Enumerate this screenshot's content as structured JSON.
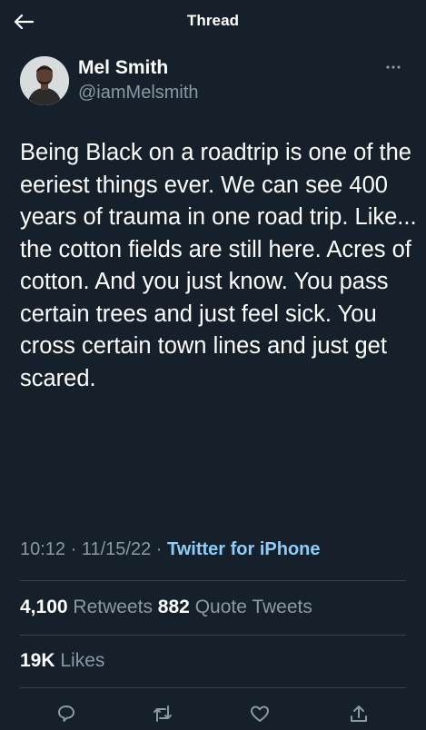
{
  "header": {
    "title": "Thread",
    "back_icon": "arrow-left-icon"
  },
  "author": {
    "name": "Mel Smith",
    "handle": "@iamMelsmith"
  },
  "tweet": {
    "text": "Being Black on a roadtrip is one of the eeriest things ever. We can see 400 years of trauma in one road trip. Like... the cotton fields are still here. Acres of cotton. And you just know. You pass certain trees and just feel sick. You cross certain town lines and just get scared.",
    "time": "10:12",
    "sep1": " · ",
    "date": "11/15/22",
    "sep2": " · ",
    "source": "Twitter for iPhone"
  },
  "stats": {
    "retweets_count": "4,100",
    "retweets_label": "Retweets",
    "quotes_count": "882",
    "quotes_label": "Quote Tweets",
    "likes_count": "19K",
    "likes_label": "Likes"
  },
  "actions": [
    "reply-icon",
    "retweet-icon",
    "like-icon",
    "share-icon"
  ],
  "colors": {
    "background": "#15202b",
    "text": "#ffffff",
    "secondary": "#8b98a5",
    "link": "#8ecdf8",
    "divider": "#38444d"
  }
}
